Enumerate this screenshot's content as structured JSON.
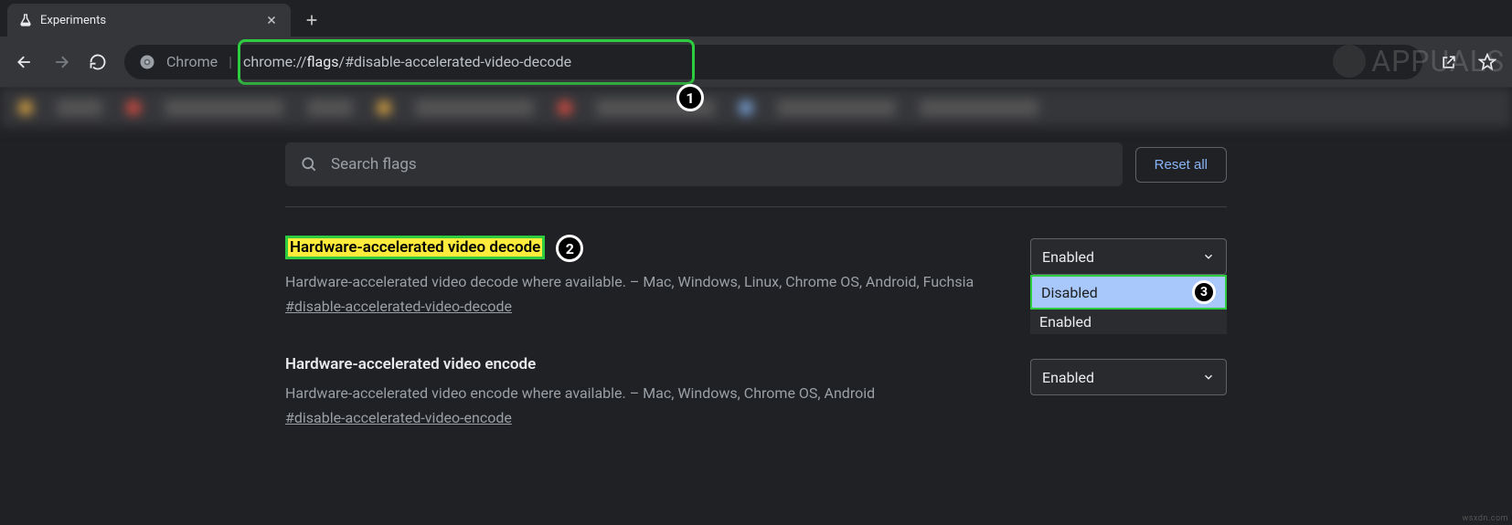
{
  "tab": {
    "title": "Experiments"
  },
  "omnibox": {
    "proto_label": "Chrome",
    "url_pre": "chrome://",
    "url_bold": "flags",
    "url_post": "/#disable-accelerated-video-decode"
  },
  "toolbar": {
    "reset_label": "Reset all",
    "search_placeholder": "Search flags"
  },
  "flags": [
    {
      "title": "Hardware-accelerated video decode",
      "desc": "Hardware-accelerated video decode where available. – Mac, Windows, Linux, Chrome OS, Android, Fuchsia",
      "hash": "#disable-accelerated-video-decode",
      "select_value": "Enabled",
      "options": {
        "disabled": "Disabled",
        "enabled": "Enabled"
      }
    },
    {
      "title": "Hardware-accelerated video encode",
      "desc": "Hardware-accelerated video encode where available. – Mac, Windows, Chrome OS, Android",
      "hash": "#disable-accelerated-video-encode",
      "select_value": "Enabled"
    }
  ],
  "annotations": {
    "b1": "1",
    "b2": "2",
    "b3": "3"
  },
  "watermark": "APPUALS",
  "credit": "wsxdn.com"
}
